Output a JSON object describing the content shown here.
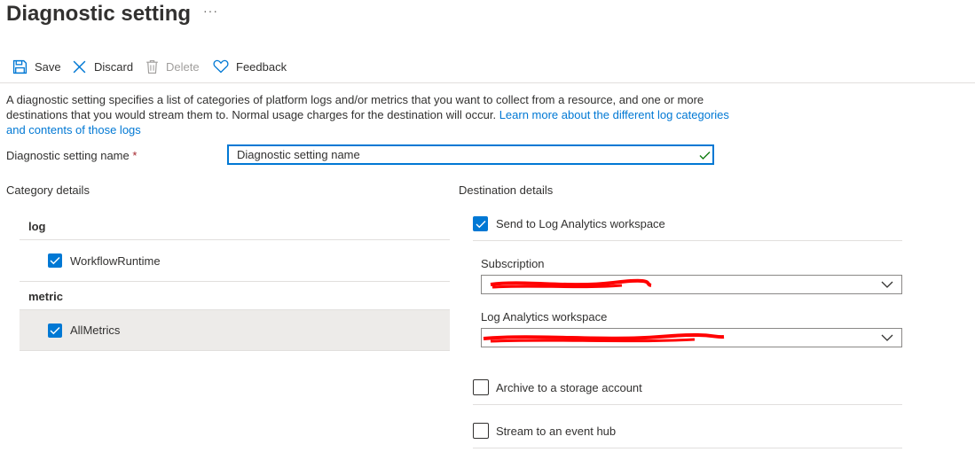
{
  "header": {
    "title": "Diagnostic setting",
    "more_label": "···"
  },
  "toolbar": {
    "save_label": "Save",
    "discard_label": "Discard",
    "delete_label": "Delete",
    "feedback_label": "Feedback"
  },
  "description": {
    "text": "A diagnostic setting specifies a list of categories of platform logs and/or metrics that you want to collect from a resource, and one or more destinations that you would stream them to. Normal usage charges for the destination will occur. ",
    "link_text": "Learn more about the different log categories and contents of those logs"
  },
  "setting_name": {
    "label": "Diagnostic setting name",
    "required_marker": "*",
    "value": "Diagnostic setting name"
  },
  "category_details": {
    "heading": "Category details",
    "groups": [
      {
        "name": "log",
        "items": [
          {
            "label": "WorkflowRuntime",
            "checked": true
          }
        ]
      },
      {
        "name": "metric",
        "items": [
          {
            "label": "AllMetrics",
            "checked": true
          }
        ]
      }
    ]
  },
  "destination_details": {
    "heading": "Destination details",
    "send_to_log_analytics": {
      "label": "Send to Log Analytics workspace",
      "checked": true
    },
    "subscription": {
      "label": "Subscription"
    },
    "workspace": {
      "label": "Log Analytics workspace"
    },
    "archive_storage": {
      "label": "Archive to a storage account",
      "checked": false
    },
    "stream_event_hub": {
      "label": "Stream to an event hub",
      "checked": false
    }
  },
  "colors": {
    "accent": "#0078d4",
    "valid": "#107c10",
    "redaction": "#ff0000",
    "selected_row": "#edebe9"
  }
}
